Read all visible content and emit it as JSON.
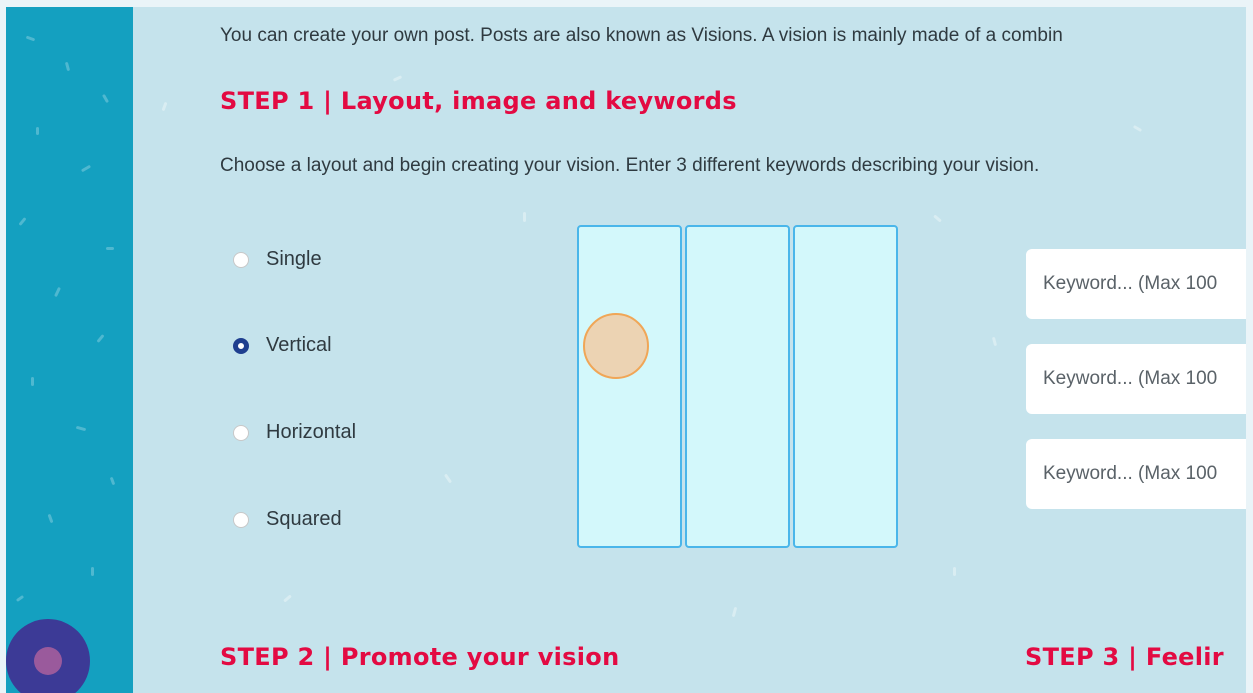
{
  "intro_text": "You can create your own post. Posts are also known as Visions. A vision is mainly made of a combin",
  "step1": {
    "title": "STEP 1 | Layout, image and keywords",
    "instructions": "Choose a layout and begin creating your vision. Enter 3 different keywords describing your vision."
  },
  "layouts": {
    "options": [
      {
        "label": "Single",
        "checked": false
      },
      {
        "label": "Vertical",
        "checked": true
      },
      {
        "label": "Horizontal",
        "checked": false
      },
      {
        "label": "Squared",
        "checked": false
      }
    ]
  },
  "keywords": {
    "placeholder": "Keyword... (Max 100"
  },
  "step2": {
    "title": "STEP 2 | Promote your vision"
  },
  "step3": {
    "title": "STEP 3 | Feelir"
  },
  "colors": {
    "accent": "#e30a42",
    "sidebar": "#14a0c0",
    "content_bg": "#c5e3ec",
    "radio_checked": "#1f3f8f",
    "panel_border": "#4ab6ea",
    "panel_fill": "#d3f8fb",
    "touch_indicator": "#f0a657"
  }
}
